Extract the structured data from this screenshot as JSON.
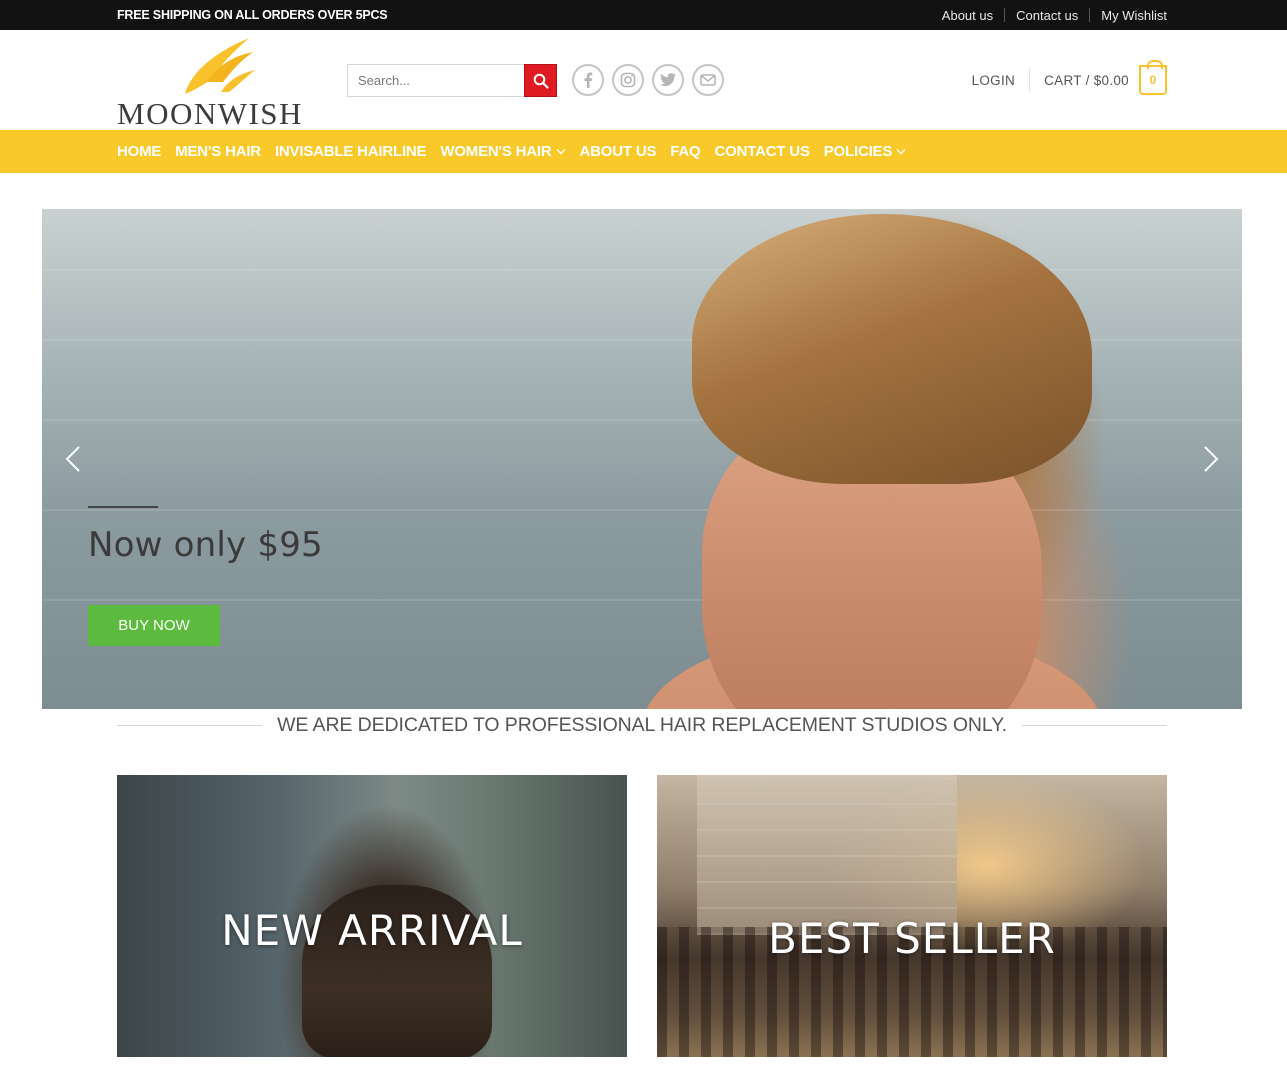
{
  "topbar": {
    "promo": "FREE SHIPPING ON ALL ORDERS OVER 5PCS",
    "links": [
      "About us",
      "Contact us",
      "My Wishlist"
    ]
  },
  "header": {
    "logo_text": "MOONWISH",
    "search_placeholder": "Search...",
    "socials": [
      "facebook-icon",
      "instagram-icon",
      "twitter-icon",
      "email-icon"
    ],
    "login": "LOGIN",
    "cart": "CART / $0.00",
    "cart_count": "0"
  },
  "nav": {
    "items": [
      {
        "label": "HOME"
      },
      {
        "label": "MEN'S HAIR"
      },
      {
        "label": "INVISABLE HAIRLINE"
      },
      {
        "label": "WOMEN'S HAIR"
      },
      {
        "label": "ABOUT US"
      },
      {
        "label": "FAQ"
      },
      {
        "label": "CONTACT US"
      },
      {
        "label": "POLICIES"
      }
    ]
  },
  "hero": {
    "headline": "Now only $95",
    "button": "BUY NOW"
  },
  "tagline": "WE ARE DEDICATED TO PROFESSIONAL HAIR REPLACEMENT STUDIOS ONLY.",
  "tiles": {
    "new_arrival": "NEW ARRIVAL",
    "best_seller": "BEST SELLER"
  },
  "colors": {
    "accent_yellow": "#f9c92a",
    "search_red": "#e01a22",
    "buy_green": "#5cbb3e",
    "topbar_bg": "#121212"
  }
}
